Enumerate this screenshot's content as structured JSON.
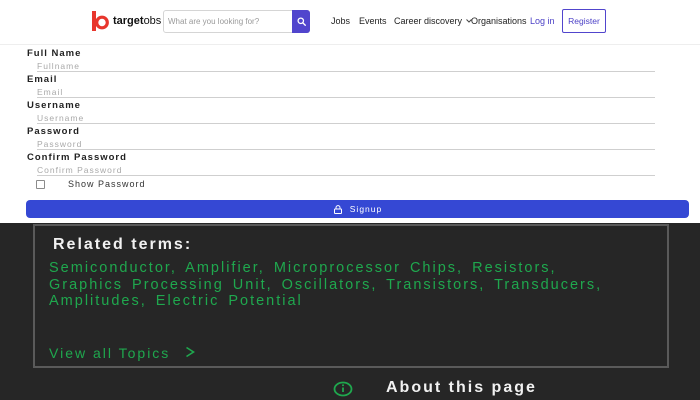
{
  "header": {
    "logo": {
      "brand": "target",
      "suffix": "obs",
      "brand_color": "#e8362d"
    },
    "search": {
      "placeholder": "What are you looking for?",
      "value": "",
      "button_icon": "search-icon",
      "button_color": "#5145cd"
    },
    "nav": [
      {
        "label": "Jobs"
      },
      {
        "label": "Events"
      },
      {
        "label": "Career discovery",
        "icon": "chevron-down-icon"
      },
      {
        "label": "Organisations"
      }
    ],
    "login_label": "Log in",
    "register_label": "Register",
    "accent_color": "#5145cd"
  },
  "form": {
    "fields": [
      {
        "label": "Full Name",
        "placeholder": "Fullname",
        "value": ""
      },
      {
        "label": "Email",
        "placeholder": "Email",
        "value": ""
      },
      {
        "label": "Username",
        "placeholder": "Username",
        "value": ""
      },
      {
        "label": "Password",
        "placeholder": "Password",
        "value": ""
      },
      {
        "label": "Confirm Password",
        "placeholder": "Confirm Password",
        "value": ""
      }
    ],
    "show_password": {
      "label": "Show Password",
      "checked": false
    },
    "signup": {
      "label": "Signup",
      "icon": "lock-icon",
      "color": "#3548d4"
    }
  },
  "related": {
    "title": "Related terms:",
    "terms_text": "Semiconductor, Amplifier, Microprocessor Chips, Resistors, Graphics Processing Unit, Oscillators, Transistors, Transducers, Amplitudes, Electric Potential",
    "view_all_label": "View all Topics",
    "view_all_icon": "chevron-right-icon",
    "link_color": "#1fa84e",
    "background_color": "#262626"
  },
  "about": {
    "label": "About this page",
    "icon": "info-icon"
  }
}
